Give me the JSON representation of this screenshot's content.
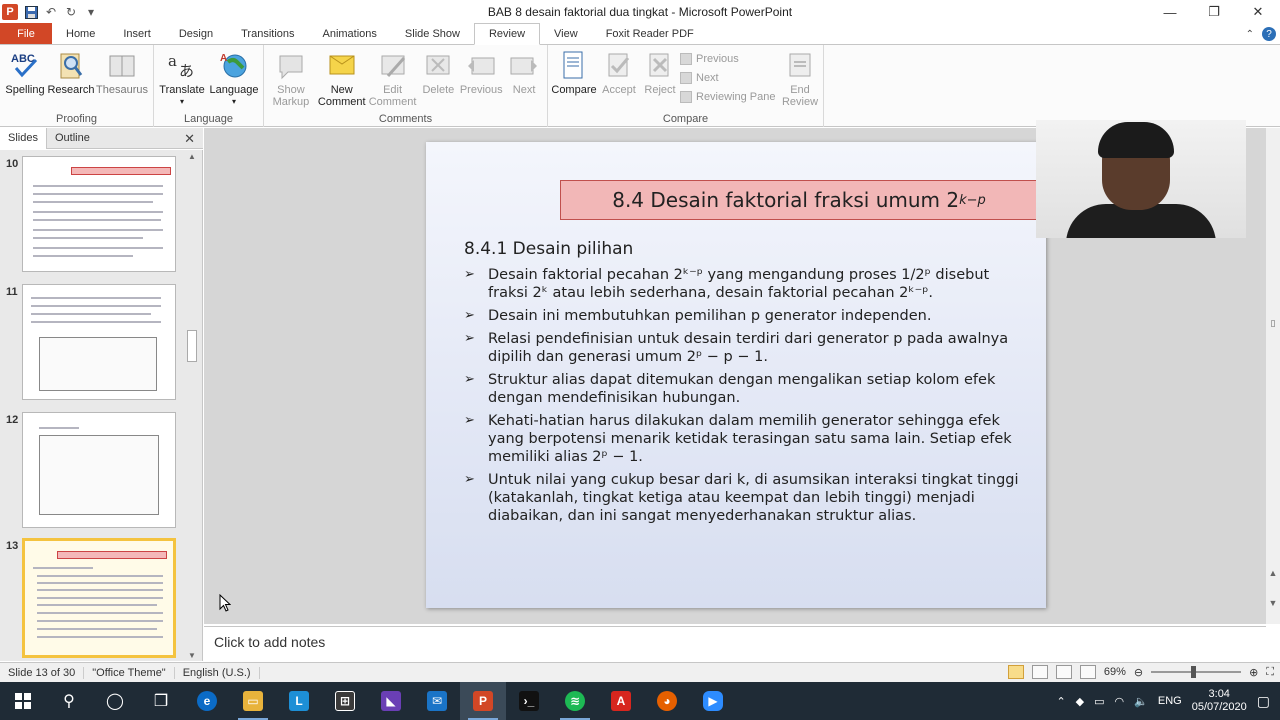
{
  "window": {
    "title": "BAB 8 desain faktorial dua tingkat  -  Microsoft PowerPoint",
    "minimize": "—",
    "restore": "❐",
    "close": "✕"
  },
  "tabs": [
    {
      "label": "File",
      "active": false
    },
    {
      "label": "Home",
      "active": false
    },
    {
      "label": "Insert",
      "active": false
    },
    {
      "label": "Design",
      "active": false
    },
    {
      "label": "Transitions",
      "active": false
    },
    {
      "label": "Animations",
      "active": false
    },
    {
      "label": "Slide Show",
      "active": false
    },
    {
      "label": "Review",
      "active": true
    },
    {
      "label": "View",
      "active": false
    },
    {
      "label": "Foxit Reader PDF",
      "active": false
    }
  ],
  "ribbon": {
    "proofing": {
      "label": "Proofing",
      "spelling": "Spelling",
      "research": "Research",
      "thesaurus": "Thesaurus"
    },
    "language": {
      "label": "Language",
      "translate": "Translate",
      "language": "Language"
    },
    "comments": {
      "label": "Comments",
      "show_markup_1": "Show",
      "show_markup_2": "Markup",
      "new_comment_1": "New",
      "new_comment_2": "Comment",
      "edit_comment_1": "Edit",
      "edit_comment_2": "Comment",
      "delete": "Delete",
      "previous": "Previous",
      "next": "Next"
    },
    "compare": {
      "label": "Compare",
      "compare": "Compare",
      "accept": "Accept",
      "reject": "Reject",
      "previous": "Previous",
      "next": "Next",
      "reviewing_pane": "Reviewing Pane",
      "end_review_1": "End",
      "end_review_2": "Review"
    }
  },
  "pane": {
    "tab_slides": "Slides",
    "tab_outline": "Outline",
    "close": "✕",
    "thumbnails": [
      {
        "num": "10"
      },
      {
        "num": "11"
      },
      {
        "num": "12"
      },
      {
        "num": "13"
      }
    ]
  },
  "slide": {
    "title_text": "8.4 Desain faktorial fraksi umum 2",
    "title_sup": "k−p",
    "subtitle": "8.4.1 Desain pilihan",
    "bullets": [
      "Desain faktorial pecahan 2ᵏ⁻ᵖ yang mengandung proses 1/2ᵖ disebut fraksi 2ᵏ atau lebih sederhana, desain faktorial pecahan 2ᵏ⁻ᵖ.",
      "Desain ini membutuhkan pemilihan p generator independen.",
      "Relasi pendefinisian untuk desain terdiri dari generator p pada awalnya dipilih dan generasi umum 2ᵖ − p − 1.",
      "Struktur alias dapat ditemukan dengan mengalikan setiap kolom efek dengan mendefinisikan hubungan.",
      "Kehati-hatian harus dilakukan dalam memilih generator sehingga efek yang berpotensi menarik ketidak terasingan satu sama lain. Setiap efek memiliki alias 2ᵖ − 1.",
      "Untuk nilai yang cukup besar dari k, di asumsikan interaksi tingkat tinggi (katakanlah, tingkat ketiga atau keempat dan lebih tinggi) menjadi diabaikan, dan ini sangat menyederhanakan struktur alias."
    ]
  },
  "notes": {
    "placeholder": "Click to add notes"
  },
  "status": {
    "slide_of": "Slide 13 of 30",
    "theme": "\"Office Theme\"",
    "language": "English (U.S.)",
    "zoom": "69%"
  },
  "taskbar": {
    "lang": "ENG",
    "time": "3:04",
    "date": "05/07/2020"
  },
  "colors": {
    "file_tab": "#d24726",
    "title_box": "#f2b7b7",
    "active_thumb": "#f4c33f",
    "taskbar": "#1f2b36"
  }
}
